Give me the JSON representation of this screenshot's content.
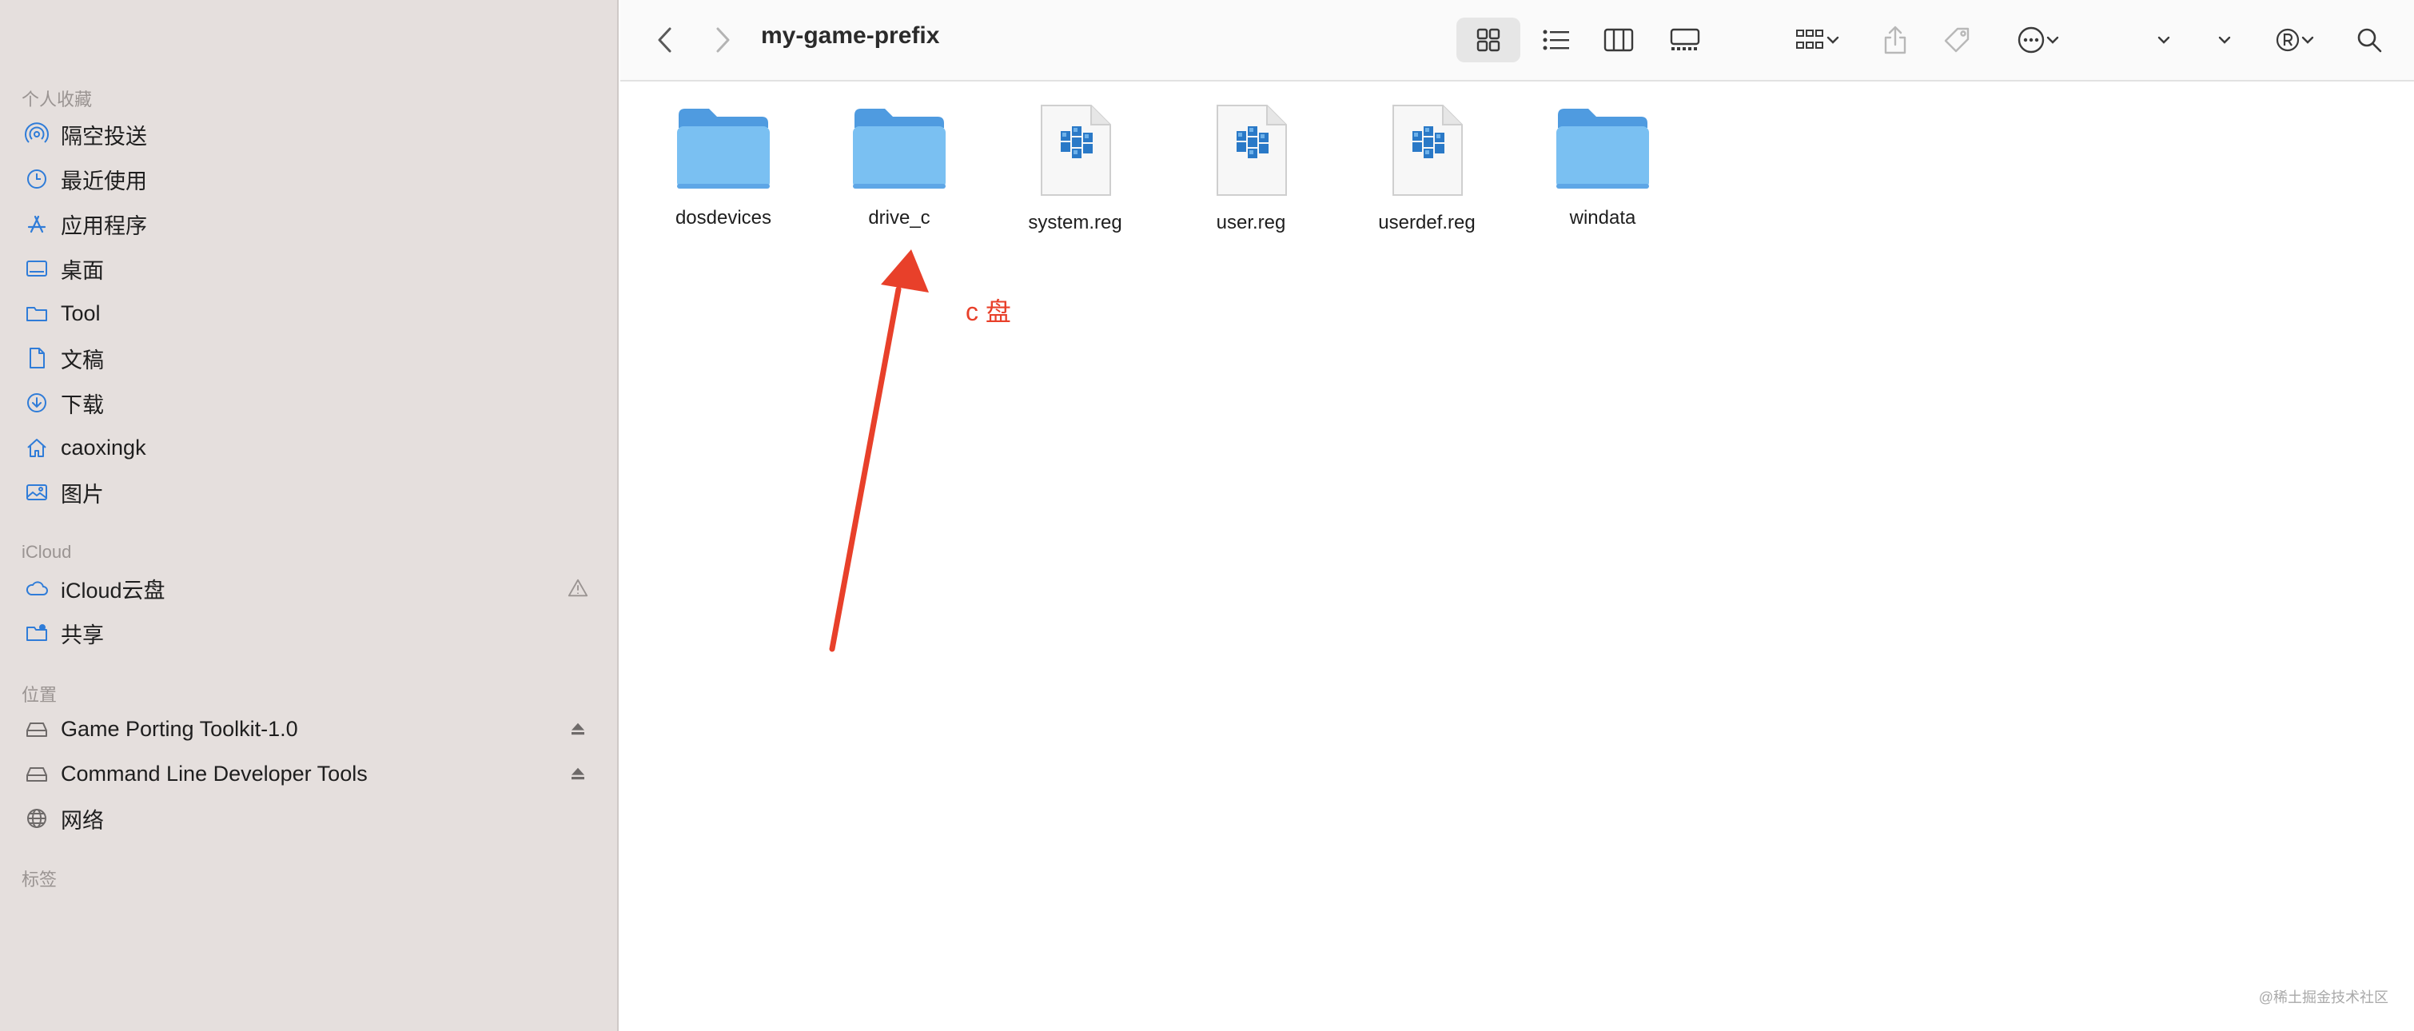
{
  "sidebar": {
    "favorites_title": "个人收藏",
    "favorites": [
      {
        "label": "隔空投送",
        "icon": "airdrop-icon"
      },
      {
        "label": "最近使用",
        "icon": "clock-icon"
      },
      {
        "label": "应用程序",
        "icon": "applications-icon"
      },
      {
        "label": "桌面",
        "icon": "desktop-icon"
      },
      {
        "label": "Tool",
        "icon": "folder-icon"
      },
      {
        "label": "文稿",
        "icon": "document-icon"
      },
      {
        "label": "下载",
        "icon": "download-icon"
      },
      {
        "label": "caoxingk",
        "icon": "home-icon"
      },
      {
        "label": "图片",
        "icon": "photo-icon"
      }
    ],
    "icloud_title": "iCloud",
    "icloud": [
      {
        "label": "iCloud云盘",
        "icon": "cloud-icon",
        "trailing": "warning-icon"
      },
      {
        "label": "共享",
        "icon": "shared-folder-icon"
      }
    ],
    "locations_title": "位置",
    "locations": [
      {
        "label": "Game Porting Toolkit-1.0",
        "icon": "disk-icon",
        "trailing": "eject-icon"
      },
      {
        "label": "Command Line Developer Tools",
        "icon": "disk-icon",
        "trailing": "eject-icon"
      },
      {
        "label": "网络",
        "icon": "network-icon"
      }
    ],
    "tags_title": "标签"
  },
  "toolbar": {
    "title": "my-game-prefix"
  },
  "files": [
    {
      "name": "dosdevices",
      "type": "folder"
    },
    {
      "name": "drive_c",
      "type": "folder"
    },
    {
      "name": "system.reg",
      "type": "reg",
      "badge": "REG"
    },
    {
      "name": "user.reg",
      "type": "reg",
      "badge": "REG"
    },
    {
      "name": "userdef.reg",
      "type": "reg",
      "badge": "REG"
    },
    {
      "name": "windata",
      "type": "folder"
    }
  ],
  "annotation": {
    "text": "c 盘",
    "color": "#e8402a"
  },
  "watermark": "@稀土掘金技术社区",
  "colors": {
    "sidebar_bg": "#e5dfdd",
    "accent_blue": "#2f7cd8",
    "folder_blue": "#7ac0f2"
  }
}
